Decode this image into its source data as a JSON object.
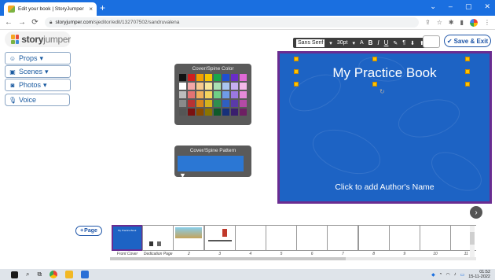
{
  "browser": {
    "tab_title": "Edit your book | StoryJumper",
    "tab_close": "×",
    "new_tab": "+",
    "url_host": "storyjumper.com",
    "url_path": "/sjeditor/edit/132707502/sandruvalena",
    "window_controls": [
      "⌄",
      "–",
      "▢",
      "✕"
    ]
  },
  "logo": {
    "brand_bold": "story",
    "brand_light": "jumper"
  },
  "sidebar": {
    "items": [
      {
        "label": "Props",
        "caret": "▾",
        "icon": "smiley-icon"
      },
      {
        "label": "Scenes",
        "caret": "▾",
        "icon": "image-icon"
      },
      {
        "label": "Photos",
        "caret": "▾",
        "icon": "camera-icon"
      }
    ],
    "voice": {
      "label": "Voice",
      "icon": "microphone-icon"
    }
  },
  "palette": {
    "label": "Cover/Spine Color",
    "colors": [
      "#111111",
      "#d01f1f",
      "#f2a000",
      "#f5c400",
      "#19a64a",
      "#1f4fd1",
      "#6a2cc7",
      "#e06ad6",
      "#ffffff",
      "#f4a7a7",
      "#f6c98e",
      "#f7e59a",
      "#a9e0b3",
      "#a9c4f2",
      "#c7aef0",
      "#f3b8e8",
      "#bdbdbd",
      "#e37373",
      "#f0b05c",
      "#f4d35e",
      "#6fcf86",
      "#6f9be8",
      "#9b78e3",
      "#e58ad8",
      "#8a8a8a",
      "#b83333",
      "#d9861a",
      "#d4b21e",
      "#2f8f4e",
      "#2f5fc0",
      "#5b3aa8",
      "#b34aa5",
      "#555555",
      "#7a1111",
      "#8a4a00",
      "#8a7400",
      "#0f5a2a",
      "#17307a",
      "#3a1f6e",
      "#6e1f63"
    ]
  },
  "pattern": {
    "label": "Cover/Spine Pattern",
    "chevron": "▼"
  },
  "toolbar": {
    "font": "Sans Serif",
    "font_caret": "▾",
    "size": "30pt",
    "size_caret": "▾",
    "buttons": [
      "B",
      "I",
      "U",
      "¶"
    ]
  },
  "save_exit": {
    "label": "Save & Exit",
    "icon": "check-circle-icon"
  },
  "cover": {
    "title": "My Practice Book",
    "author_placeholder": "Click to add Author's Name"
  },
  "add_page": {
    "label": "Page",
    "icon": "+"
  },
  "pages": [
    {
      "label": "Front Cover",
      "selected": true,
      "mini": "My Practice Book"
    },
    {
      "label": "Dedication Page"
    },
    {
      "label": "2"
    },
    {
      "label": "3"
    },
    {
      "label": "4"
    },
    {
      "label": "5"
    },
    {
      "label": "6"
    },
    {
      "label": "7"
    },
    {
      "label": "8"
    },
    {
      "label": "9"
    },
    {
      "label": "10"
    },
    {
      "label": "11"
    }
  ],
  "taskbar": {
    "time": "01:52",
    "date": "15-11-2022"
  }
}
